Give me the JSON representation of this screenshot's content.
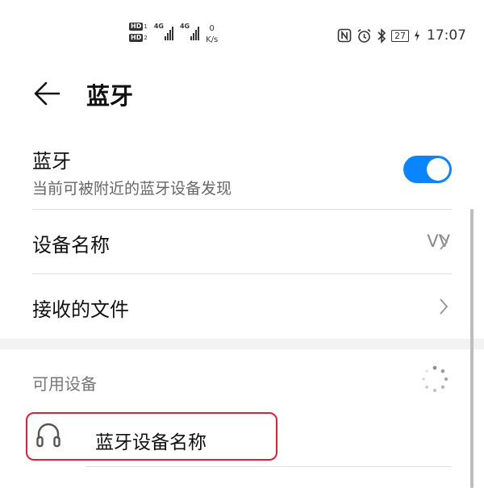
{
  "statusbar": {
    "hd1": "HD",
    "hd1_sub": "1",
    "hd2": "HD",
    "hd2_sub": "2",
    "net1": "4G",
    "net2": "4G",
    "speed_value": "0",
    "speed_unit": "K/s",
    "battery": "27",
    "time": "17:07",
    "icons": [
      "nfc-icon",
      "alarm-icon",
      "bluetooth-icon",
      "battery-icon",
      "charging-icon"
    ]
  },
  "header": {
    "title": "蓝牙",
    "back_icon": "back-arrow-icon"
  },
  "bluetooth_toggle": {
    "label": "蓝牙",
    "description": "当前可被附近的蓝牙设备发现",
    "enabled": true,
    "accent": "#0a84ff"
  },
  "device_name_row": {
    "label": "设备名称",
    "value": "VV"
  },
  "received_files_row": {
    "label": "接收的文件"
  },
  "available_devices": {
    "section_label": "可用设备",
    "items": [
      {
        "name": "蓝牙设备名称",
        "icon": "headset-icon"
      }
    ]
  },
  "highlight_color": "#e0203a"
}
